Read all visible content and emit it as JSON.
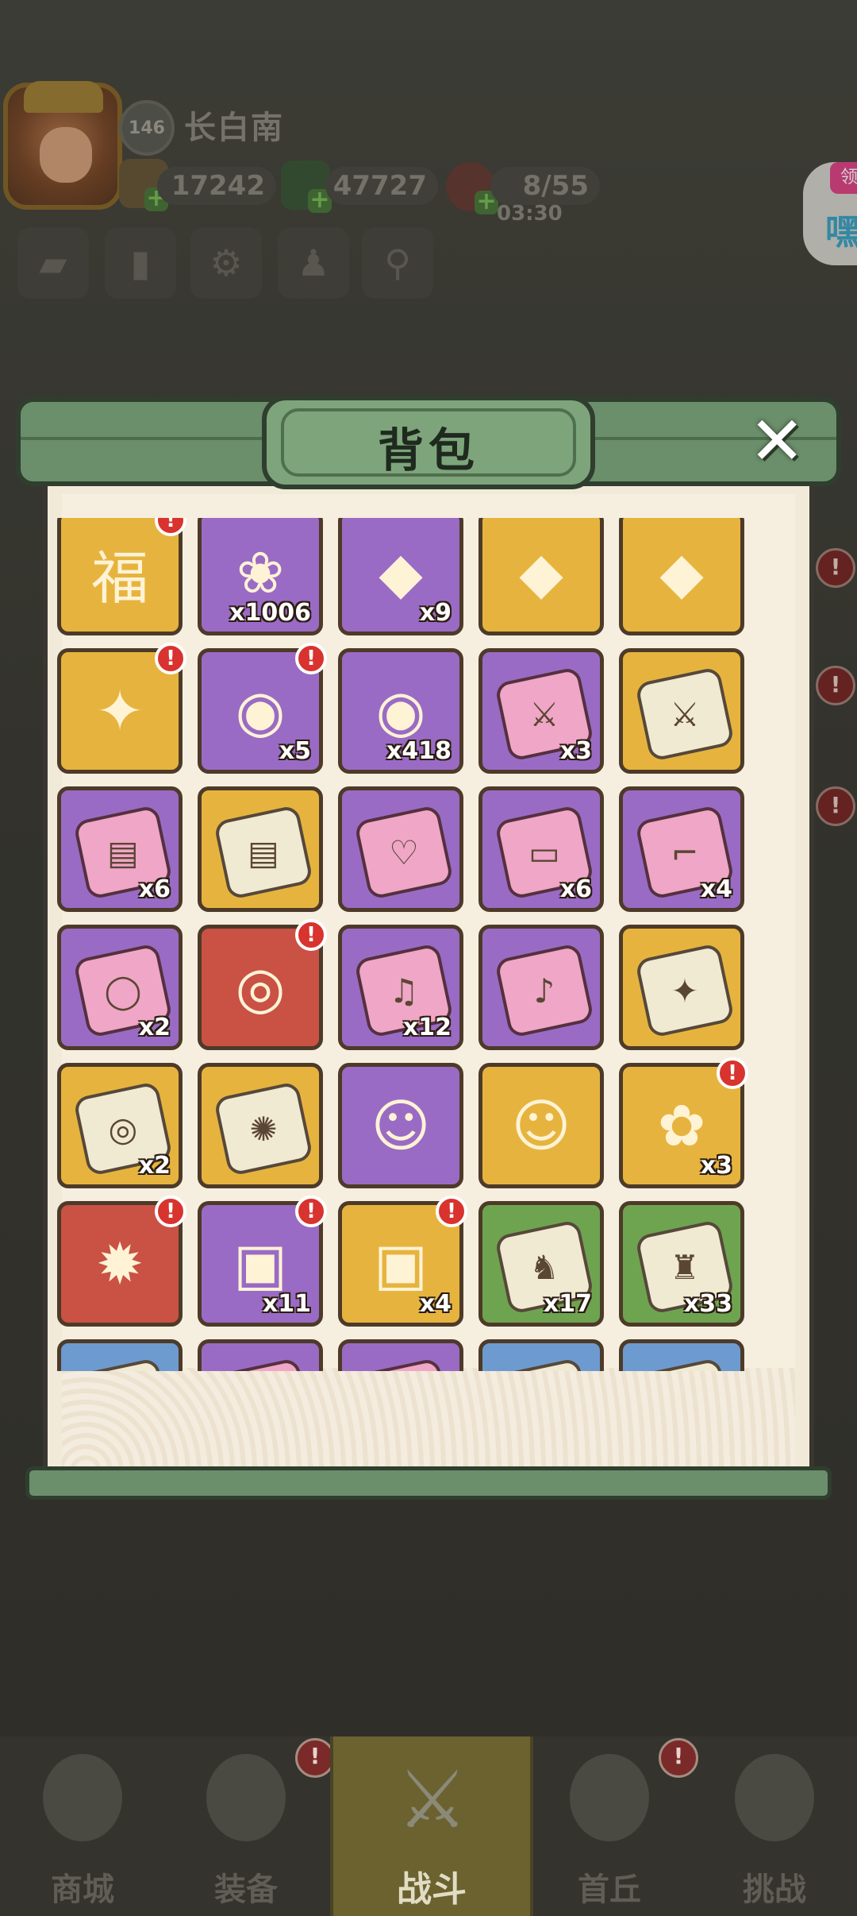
{
  "player": {
    "level": "146",
    "name": "长白南",
    "coins": "17242",
    "jade": "47727",
    "stamina": "8/55",
    "stamina_timer": "03:30"
  },
  "side_badge": {
    "tag": "领",
    "glyph": "嘿"
  },
  "bag": {
    "title": "背包",
    "close_label": "✕",
    "items": [
      {
        "color": "gold",
        "icon": "lucky-bag-icon",
        "count": "",
        "alert": true
      },
      {
        "color": "purple",
        "icon": "crystal-lotus-icon",
        "count": "x1006",
        "alert": false
      },
      {
        "color": "purple",
        "icon": "lotus-gem-icon",
        "count": "x9",
        "alert": false
      },
      {
        "color": "gold",
        "icon": "phoenix-gem-icon",
        "count": "",
        "alert": false
      },
      {
        "color": "gold",
        "icon": "spirit-gem-icon",
        "count": "",
        "alert": false
      },
      {
        "color": "gold",
        "icon": "gold-chest-icon",
        "count": "",
        "alert": true
      },
      {
        "color": "purple",
        "icon": "gold-bag-icon",
        "count": "x5",
        "alert": true
      },
      {
        "color": "purple",
        "icon": "gold-bag-icon",
        "count": "x418",
        "alert": false
      },
      {
        "color": "purple",
        "icon": "sword-fragment-icon",
        "count": "x3",
        "alert": false
      },
      {
        "color": "gold",
        "icon": "sword-fragment-icon",
        "count": "",
        "alert": false
      },
      {
        "color": "purple",
        "icon": "armor-fragment-icon",
        "count": "x6",
        "alert": false
      },
      {
        "color": "gold",
        "icon": "armor-fragment-icon",
        "count": "",
        "alert": false
      },
      {
        "color": "purple",
        "icon": "necklace-fragment-icon",
        "count": "",
        "alert": false
      },
      {
        "color": "purple",
        "icon": "belt-fragment-icon",
        "count": "x6",
        "alert": false
      },
      {
        "color": "purple",
        "icon": "boots-fragment-icon",
        "count": "x4",
        "alert": false
      },
      {
        "color": "purple",
        "icon": "ring-fragment-icon",
        "count": "x2",
        "alert": false
      },
      {
        "color": "red",
        "icon": "dark-orb-icon",
        "count": "",
        "alert": true
      },
      {
        "color": "purple",
        "icon": "lute-fragment-icon",
        "count": "x12",
        "alert": false
      },
      {
        "color": "purple",
        "icon": "bell-fragment-icon",
        "count": "",
        "alert": false
      },
      {
        "color": "gold",
        "icon": "drum-fragment-icon",
        "count": "",
        "alert": false
      },
      {
        "color": "gold",
        "icon": "mirror-fragment-icon",
        "count": "x2",
        "alert": false
      },
      {
        "color": "gold",
        "icon": "fan-fragment-icon",
        "count": "",
        "alert": false
      },
      {
        "color": "purple",
        "icon": "hero-portrait-icon",
        "count": "",
        "alert": false
      },
      {
        "color": "gold",
        "icon": "heroine-portrait-icon",
        "count": "",
        "alert": false
      },
      {
        "color": "gold",
        "icon": "jade-talisman-icon",
        "count": "x3",
        "alert": true
      },
      {
        "color": "red",
        "icon": "gold-talisman-icon",
        "count": "",
        "alert": true
      },
      {
        "color": "purple",
        "icon": "purple-chest-icon",
        "count": "x11",
        "alert": true
      },
      {
        "color": "gold",
        "icon": "wooden-chest-icon",
        "count": "x4",
        "alert": true
      },
      {
        "color": "green",
        "icon": "rooster-fragment-icon",
        "count": "x17",
        "alert": false
      },
      {
        "color": "green",
        "icon": "beast-fragment-icon",
        "count": "x33",
        "alert": false
      },
      {
        "color": "blue",
        "icon": "fragment-icon",
        "count": "",
        "alert": false
      },
      {
        "color": "purple",
        "icon": "fragment-icon",
        "count": "",
        "alert": false
      },
      {
        "color": "purple",
        "icon": "fragment-icon",
        "count": "",
        "alert": false
      },
      {
        "color": "blue",
        "icon": "fragment-icon",
        "count": "",
        "alert": false
      },
      {
        "color": "blue",
        "icon": "fragment-icon",
        "count": "",
        "alert": false
      }
    ]
  },
  "nav": {
    "shop": "商城",
    "equip": "装备",
    "battle": "战斗",
    "hero": "首丘",
    "challenge": "挑战"
  },
  "alert_mark": "!"
}
